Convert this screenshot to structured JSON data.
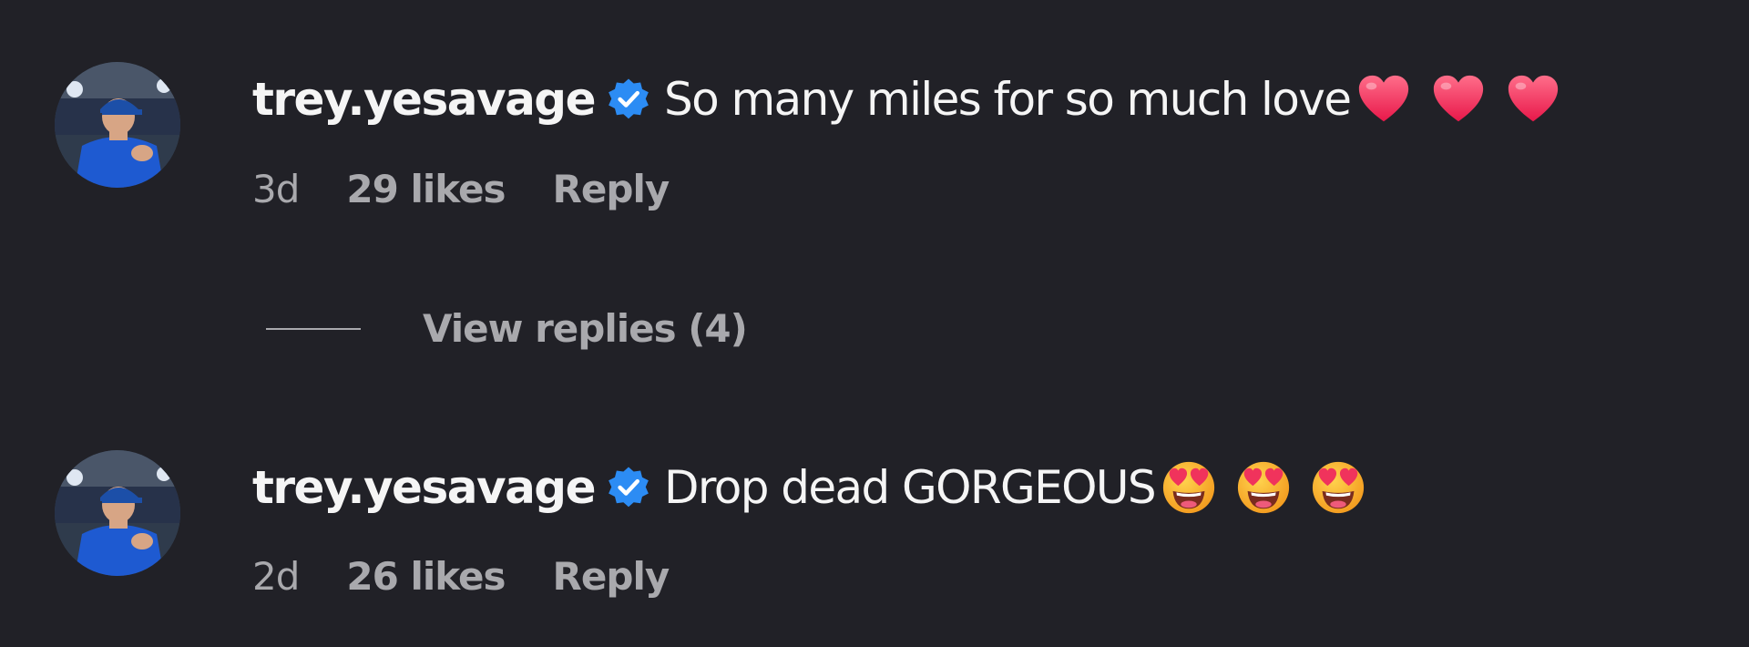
{
  "comments": [
    {
      "username": "trey.yesavage",
      "verified": true,
      "text": "So many miles for so much love",
      "emojis": [
        "red-heart",
        "red-heart",
        "red-heart"
      ],
      "time": "3d",
      "likes": "29 likes",
      "reply_label": "Reply",
      "view_replies_label": "View replies (4)"
    },
    {
      "username": "trey.yesavage",
      "verified": true,
      "text": "Drop dead GORGEOUS ",
      "emojis": [
        "heart-eyes-face",
        "heart-eyes-face",
        "heart-eyes-face"
      ],
      "time": "2d",
      "likes": "26 likes",
      "reply_label": "Reply"
    }
  ],
  "colors": {
    "background": "#212127",
    "text_primary": "#f5f5f5",
    "text_secondary": "#a9a9ad",
    "verified_badge": "#2c8cf4"
  }
}
